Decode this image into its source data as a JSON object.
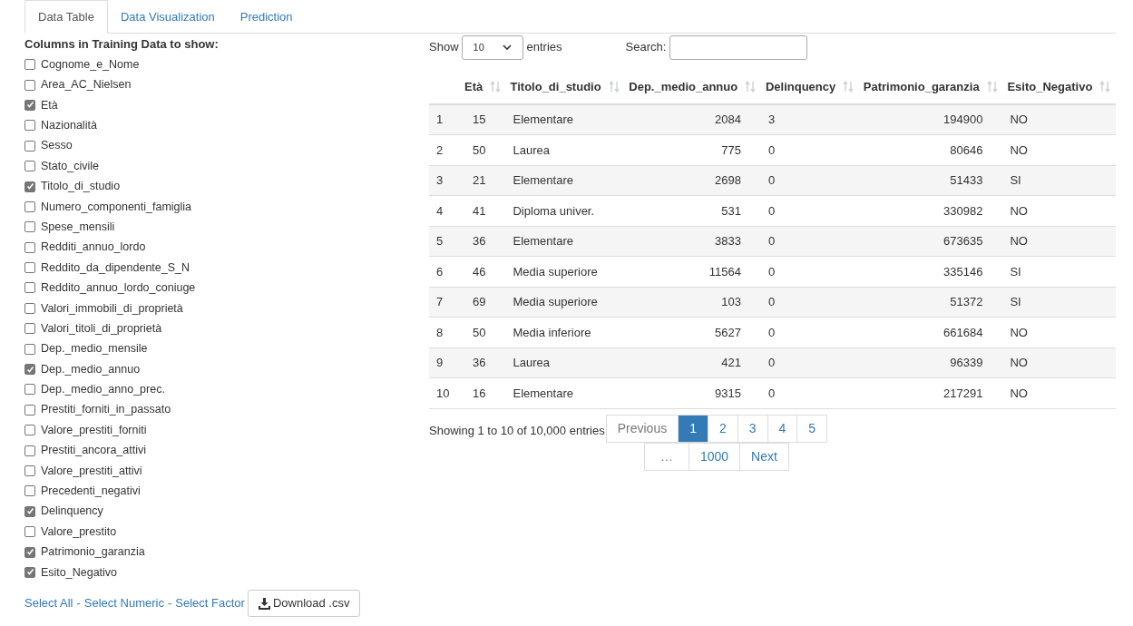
{
  "tabs": [
    {
      "label": "Data Table",
      "selected": true
    },
    {
      "label": "Data Visualization",
      "selected": false
    },
    {
      "label": "Prediction",
      "selected": false
    }
  ],
  "columns_panel": {
    "heading": "Columns in Training Data to show:",
    "options": [
      {
        "label": "Cognome_e_Nome",
        "checked": false
      },
      {
        "label": "Area_AC_Nielsen",
        "checked": false
      },
      {
        "label": "Età",
        "checked": true
      },
      {
        "label": "Nazionalità",
        "checked": false
      },
      {
        "label": "Sesso",
        "checked": false
      },
      {
        "label": "Stato_civile",
        "checked": false
      },
      {
        "label": "Titolo_di_studio",
        "checked": true
      },
      {
        "label": "Numero_componenti_famiglia",
        "checked": false
      },
      {
        "label": "Spese_mensili",
        "checked": false
      },
      {
        "label": "Redditi_annuo_lordo",
        "checked": false
      },
      {
        "label": "Reddito_da_dipendente_S_N",
        "checked": false
      },
      {
        "label": "Reddito_annuo_lordo_coniuge",
        "checked": false
      },
      {
        "label": "Valori_immobili_di_proprietà",
        "checked": false
      },
      {
        "label": "Valori_titoli_di_proprietà",
        "checked": false
      },
      {
        "label": "Dep._medio_mensile",
        "checked": false
      },
      {
        "label": "Dep._medio_annuo",
        "checked": true
      },
      {
        "label": "Dep._medio_anno_prec.",
        "checked": false
      },
      {
        "label": "Prestiti_forniti_in_passato",
        "checked": false
      },
      {
        "label": "Valore_prestiti_forniti",
        "checked": false
      },
      {
        "label": "Prestiti_ancora_attivi",
        "checked": false
      },
      {
        "label": "Valore_prestiti_attivi",
        "checked": false
      },
      {
        "label": "Precedenti_negativi",
        "checked": false
      },
      {
        "label": "Delinquency",
        "checked": true
      },
      {
        "label": "Valore_prestito",
        "checked": false
      },
      {
        "label": "Patrimonio_garanzia",
        "checked": true
      },
      {
        "label": "Esito_Negativo",
        "checked": true
      }
    ],
    "links": [
      "Select All",
      "Select Numeric",
      "Select Factor"
    ],
    "separators": [
      "-",
      "-"
    ],
    "download_button": "Download .csv"
  },
  "table_controls": {
    "show_label": "Show",
    "page_size": "10",
    "entries_label": "entries",
    "search_label": "Search:"
  },
  "table": {
    "columns": [
      {
        "label": "Età",
        "kind": "numeric"
      },
      {
        "label": "Titolo_di_studio",
        "kind": "factor"
      },
      {
        "label": "Dep._medio_annuo",
        "kind": "numeric"
      },
      {
        "label": "Delinquency",
        "kind": "factor"
      },
      {
        "label": "Patrimonio_garanzia",
        "kind": "numeric"
      },
      {
        "label": "Esito_Negativo",
        "kind": "factor"
      }
    ],
    "rows": [
      {
        "number": "1",
        "cells": [
          "15",
          "Elementare",
          "2084",
          "3",
          "194900",
          "NO"
        ]
      },
      {
        "number": "2",
        "cells": [
          "50",
          "Laurea",
          "775",
          "0",
          "80646",
          "NO"
        ]
      },
      {
        "number": "3",
        "cells": [
          "21",
          "Elementare",
          "2698",
          "0",
          "51433",
          "SI"
        ]
      },
      {
        "number": "4",
        "cells": [
          "41",
          "Diploma univer.",
          "531",
          "0",
          "330982",
          "NO"
        ]
      },
      {
        "number": "5",
        "cells": [
          "36",
          "Elementare",
          "3833",
          "0",
          "673635",
          "NO"
        ]
      },
      {
        "number": "6",
        "cells": [
          "46",
          "Media superiore",
          "11564",
          "0",
          "335146",
          "SI"
        ]
      },
      {
        "number": "7",
        "cells": [
          "69",
          "Media superiore",
          "103",
          "0",
          "51372",
          "SI"
        ]
      },
      {
        "number": "8",
        "cells": [
          "50",
          "Media inferiore",
          "5627",
          "0",
          "661684",
          "NO"
        ]
      },
      {
        "number": "9",
        "cells": [
          "36",
          "Laurea",
          "421",
          "0",
          "96339",
          "NO"
        ]
      },
      {
        "number": "10",
        "cells": [
          "16",
          "Elementare",
          "9315",
          "0",
          "217291",
          "NO"
        ]
      }
    ]
  },
  "info": "Showing 1 to 10 of 10,000 entries",
  "pagination": [
    {
      "label": "Previous",
      "kind": "nav",
      "selected": false
    },
    {
      "label": "1",
      "kind": "page",
      "selected": true
    },
    {
      "label": "2",
      "kind": "page",
      "selected": false
    },
    {
      "label": "3",
      "kind": "page",
      "selected": false
    },
    {
      "label": "4",
      "kind": "page",
      "selected": false
    },
    {
      "label": "5",
      "kind": "page",
      "selected": false
    },
    {
      "label": "…",
      "kind": "ellipsis",
      "selected": false
    },
    {
      "label": "1000",
      "kind": "page",
      "selected": false
    },
    {
      "label": "Next",
      "kind": "nav",
      "selected": false
    }
  ]
}
